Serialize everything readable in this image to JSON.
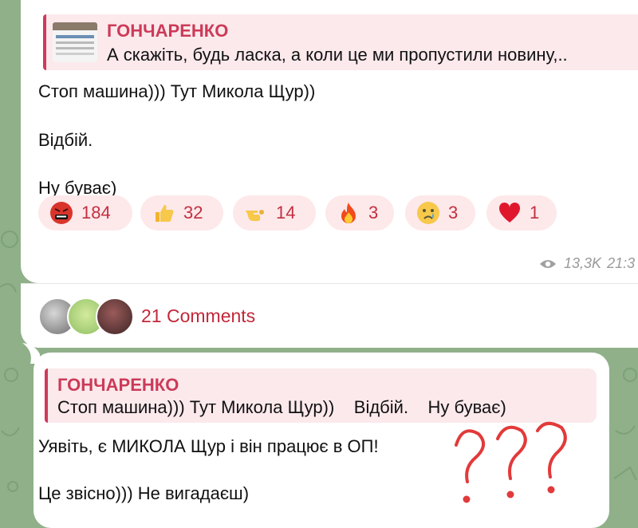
{
  "post": {
    "quote": {
      "author": "ГОНЧАРЕНКО",
      "text": "А скажіть, будь ласка, а коли це ми пропустили новину,.."
    },
    "lines": [
      "Стоп машина))) Тут Микола Щур))",
      "Відбій.",
      "Ну буває)"
    ],
    "reactions": [
      {
        "icon": "angry-face-icon",
        "count": "184"
      },
      {
        "icon": "thumbs-up-icon",
        "count": "32"
      },
      {
        "icon": "pointing-hand-icon",
        "count": "14"
      },
      {
        "icon": "fire-icon",
        "count": "3"
      },
      {
        "icon": "crying-face-icon",
        "count": "3"
      },
      {
        "icon": "red-heart-icon",
        "count": "1"
      }
    ],
    "views": "13,3K",
    "time": "21:3"
  },
  "comments": {
    "label": "21 Comments"
  },
  "reply": {
    "quote": {
      "author": "ГОНЧАРЕНКО",
      "text": "Стоп машина))) Тут Микола Щур))    Відбій.    Ну буває)"
    },
    "lines": [
      "Уявіть, є МИКОЛА Щур і він працює в ОП!",
      "Це звісно))) Не вигадаєш)"
    ],
    "annotation": "???"
  },
  "colors": {
    "background": "#8fb089",
    "accent": "#cc3a58",
    "reaction_bg": "#fde8ea",
    "annotation": "#e23a3a"
  }
}
